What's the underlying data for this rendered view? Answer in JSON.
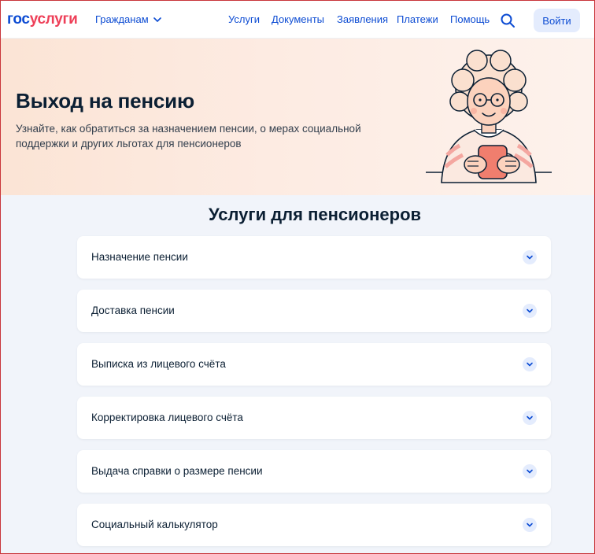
{
  "header": {
    "logo_part1": "гос",
    "logo_part2": "услуги",
    "audience_label": "Гражданам",
    "nav": [
      "Услуги",
      "Документы",
      "Заявления",
      "Платежи",
      "Помощь"
    ],
    "login_label": "Войти",
    "icons": {
      "search": "search-icon",
      "audience": "chevron-down-icon"
    }
  },
  "hero": {
    "title": "Выход на пенсию",
    "description": "Узнайте, как обратиться за назначением пенсии, о мерах социальной поддержки и других льготах для пенсионеров"
  },
  "section": {
    "title": "Услуги для пенсионеров",
    "items": [
      {
        "label": "Назначение пенсии"
      },
      {
        "label": "Доставка пенсии"
      },
      {
        "label": "Выписка из лицевого счёта"
      },
      {
        "label": "Корректировка лицевого счёта"
      },
      {
        "label": "Выдача справки о размере пенсии"
      },
      {
        "label": "Социальный калькулятор"
      }
    ]
  },
  "colors": {
    "brand_blue": "#0d4cd3",
    "brand_red": "#ee3f58",
    "page_bg": "#f1f4fa",
    "hero_bg": "#fbe4d5"
  }
}
